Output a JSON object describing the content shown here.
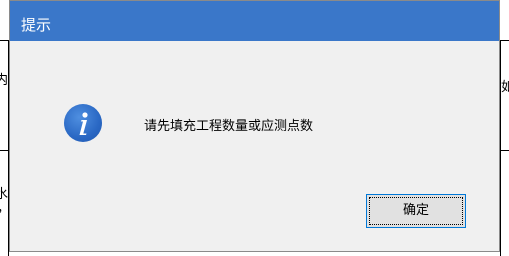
{
  "background": {
    "left_text_1": "内",
    "left_text_2": "水",
    "left_text_3": "，",
    "right_text_1": "如"
  },
  "dialog": {
    "title": "提示",
    "icon": "info-icon",
    "message": "请先填充工程数量或应测点数",
    "ok_label": "确定",
    "colors": {
      "titlebar": "#3a77c9",
      "body": "#f0f0f0",
      "icon": "#2a68c4",
      "button_border": "#0078d7"
    }
  }
}
